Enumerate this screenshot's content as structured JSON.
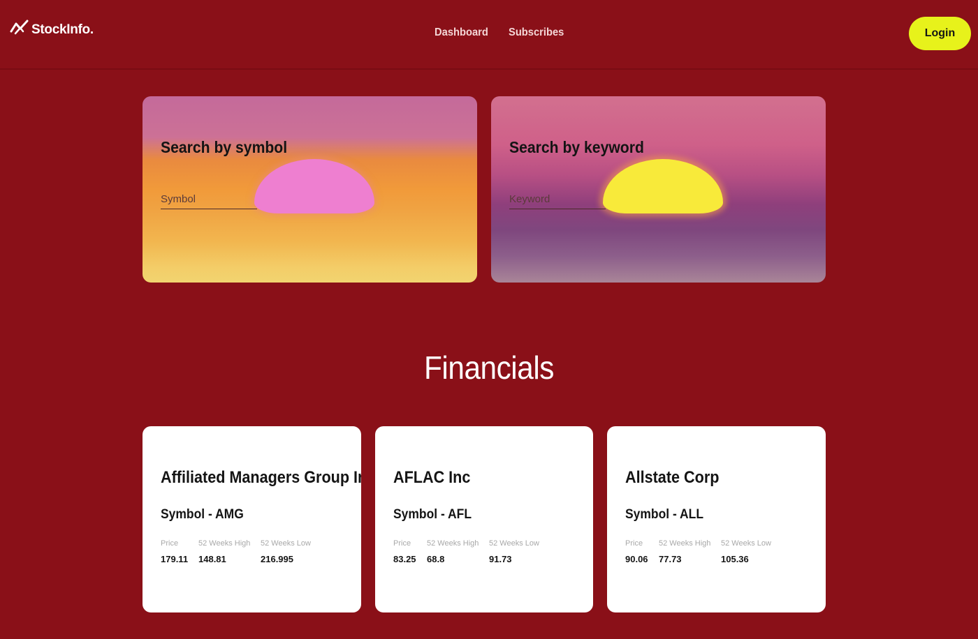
{
  "header": {
    "logo_text": "StockInfo.",
    "nav": [
      "Dashboard",
      "Subscribes"
    ],
    "login_label": "Login"
  },
  "search": {
    "symbol": {
      "title": "Search by symbol",
      "placeholder": "Symbol"
    },
    "keyword": {
      "title": "Search by keyword",
      "placeholder": "Keyword"
    }
  },
  "section_title": "Financials",
  "stats_labels": {
    "price": "Price",
    "high": "52 Weeks High",
    "low": "52 Weeks Low"
  },
  "stocks": [
    {
      "name": "Affiliated Managers Group Inc",
      "symbol": "Symbol - AMG",
      "price": "179.11",
      "high": "148.81",
      "low": "216.995"
    },
    {
      "name": "AFLAC Inc",
      "symbol": "Symbol - AFL",
      "price": "83.25",
      "high": "68.8",
      "low": "91.73"
    },
    {
      "name": "Allstate Corp",
      "symbol": "Symbol - ALL",
      "price": "90.06",
      "high": "77.73",
      "low": "105.36"
    }
  ],
  "colors": {
    "background": "#8a1018",
    "login_button": "#e7f21b",
    "card": "#ffffff"
  },
  "icons": {
    "logo": "trend-chart-icon"
  }
}
